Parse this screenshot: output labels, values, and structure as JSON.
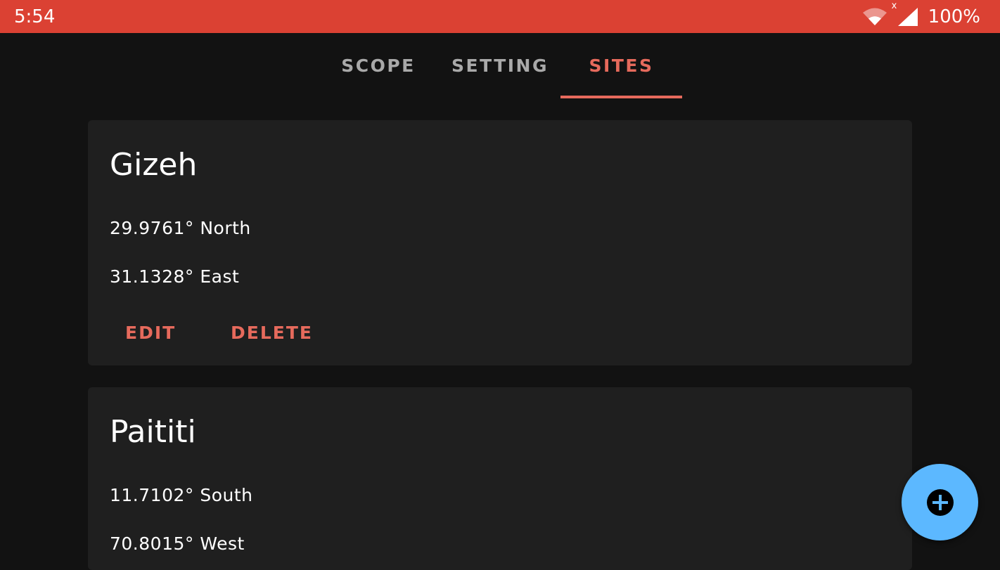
{
  "status_bar": {
    "time": "5:54",
    "battery": "100%",
    "wifi_icon": "wifi-icon",
    "signal_icon": "signal-icon",
    "signal_badge": "x"
  },
  "tabs": [
    {
      "label": "SCOPE",
      "active": false
    },
    {
      "label": "SETTING",
      "active": false
    },
    {
      "label": "SITES",
      "active": true
    }
  ],
  "sites": [
    {
      "name": "Gizeh",
      "latitude": "29.9761° North",
      "longitude": "31.1328° East",
      "edit_label": "EDIT",
      "delete_label": "DELETE"
    },
    {
      "name": "Paititi",
      "latitude": "11.7102° South",
      "longitude": "70.8015° West"
    }
  ],
  "fab": {
    "icon": "add-icon"
  },
  "colors": {
    "status_bar": "#DB4133",
    "background": "#121212",
    "card": "#1F1F1F",
    "accent": "#E66A5C",
    "fab": "#5CB8FF"
  }
}
